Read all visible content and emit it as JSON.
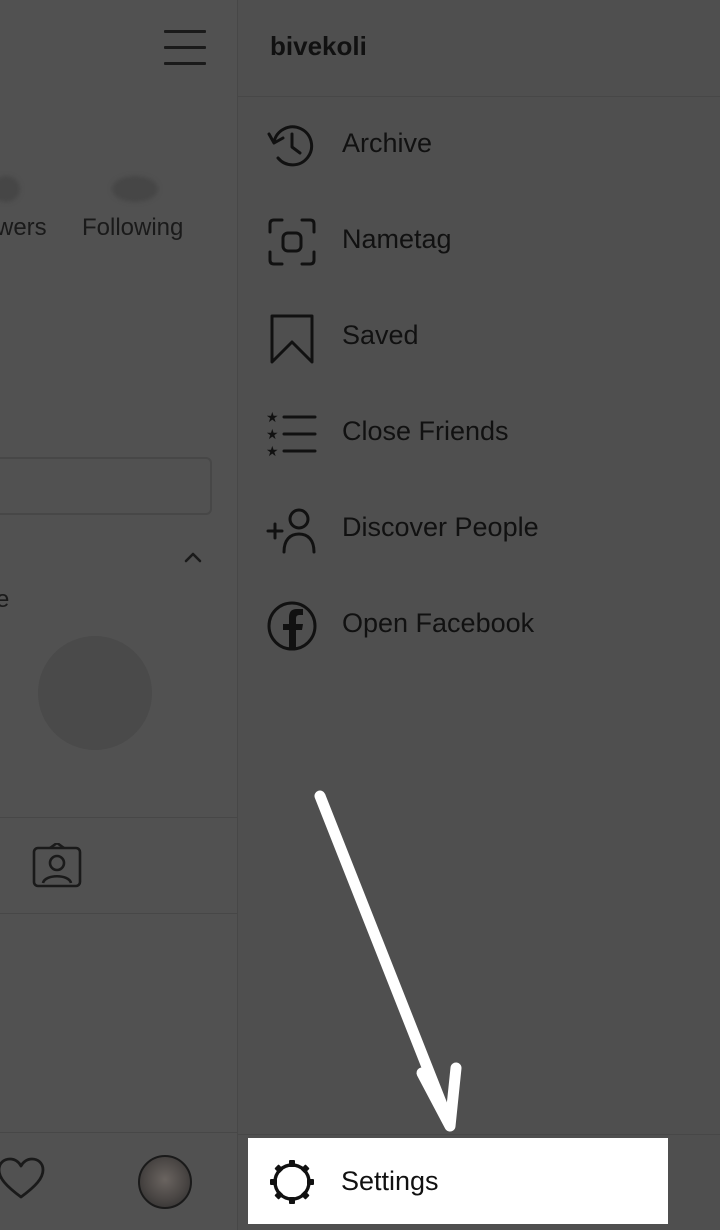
{
  "profile": {
    "followers_fragment": "wers",
    "following_label": "Following",
    "stray_text": "e"
  },
  "drawer": {
    "username": "bivekoli",
    "items": [
      {
        "label": "Archive",
        "icon": "archive-history-icon"
      },
      {
        "label": "Nametag",
        "icon": "nametag-icon"
      },
      {
        "label": "Saved",
        "icon": "bookmark-icon"
      },
      {
        "label": "Close Friends",
        "icon": "close-friends-list-icon"
      },
      {
        "label": "Discover People",
        "icon": "add-person-icon"
      },
      {
        "label": "Open Facebook",
        "icon": "facebook-icon"
      }
    ],
    "settings_label": "Settings"
  },
  "colors": {
    "overlay_dim": "#4f4f4f",
    "highlight": "#ffffff",
    "arrow": "#ffffff",
    "icon": "#111111"
  }
}
